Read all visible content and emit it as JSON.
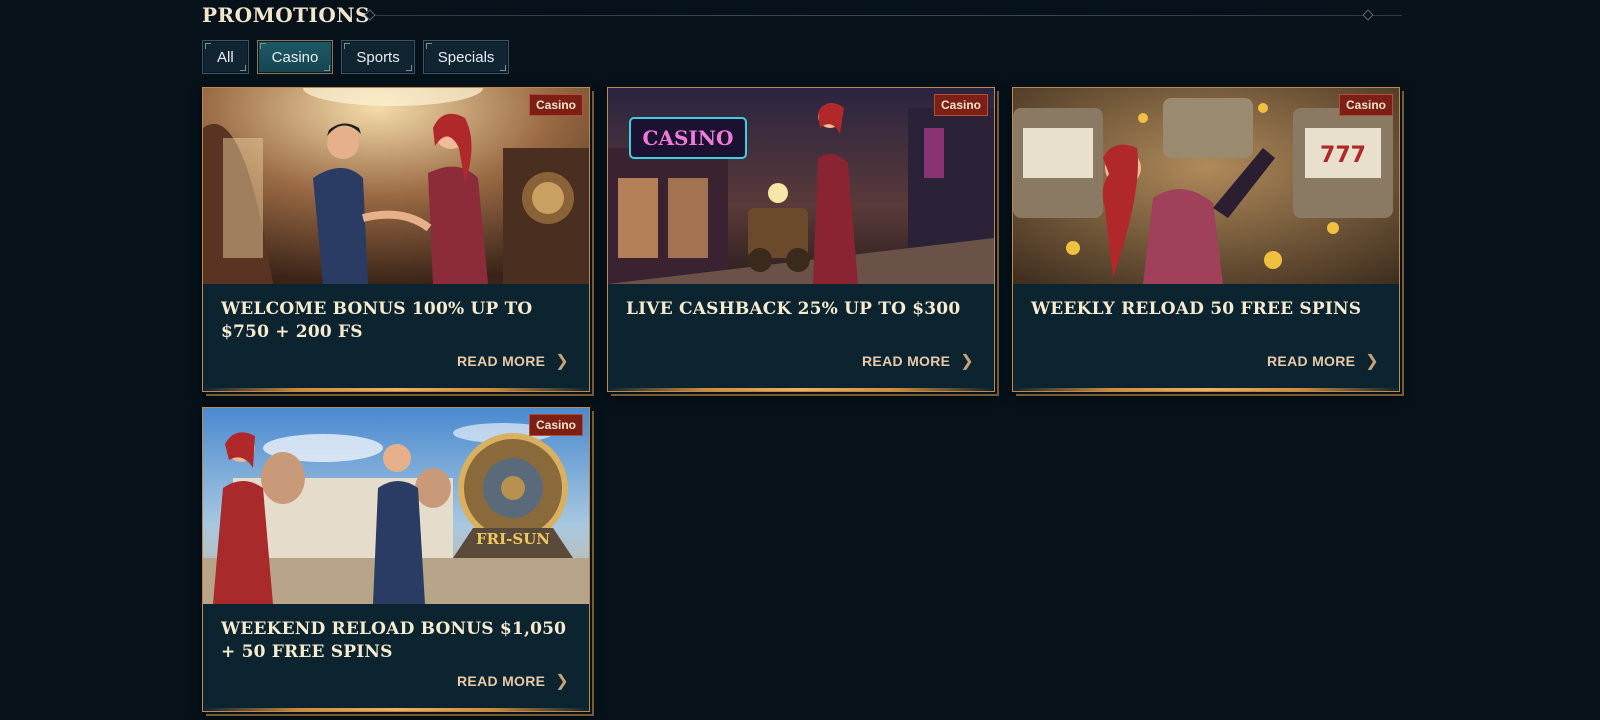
{
  "section": {
    "title": "PROMOTIONS"
  },
  "filters": [
    {
      "label": "All",
      "active": false
    },
    {
      "label": "Casino",
      "active": true
    },
    {
      "label": "Sports",
      "active": false
    },
    {
      "label": "Specials",
      "active": false
    }
  ],
  "promotions": [
    {
      "badge": "Casino",
      "title": "WELCOME BONUS 100% UP TO $750 + 200 FS",
      "cta": "READ MORE"
    },
    {
      "badge": "Casino",
      "title": "LIVE CASHBACK 25% UP TO $300",
      "cta": "READ MORE"
    },
    {
      "badge": "Casino",
      "title": "WEEKLY RELOAD 50 FREE SPINS",
      "cta": "READ MORE"
    },
    {
      "badge": "Casino",
      "title": "WEEKEND RELOAD BONUS $1,050 + 50 FREE SPINS",
      "cta": "READ MORE"
    }
  ],
  "art_text": {
    "casino_sign": "CASINO",
    "fri_sun": "FRI-SUN"
  },
  "icons": {
    "read_more": "chevron-right-icon",
    "divider": "diamond-icon"
  },
  "colors": {
    "background": "#06111a",
    "card": "#0b2430",
    "border": "#b98a52",
    "badge": "#7c1f14"
  }
}
